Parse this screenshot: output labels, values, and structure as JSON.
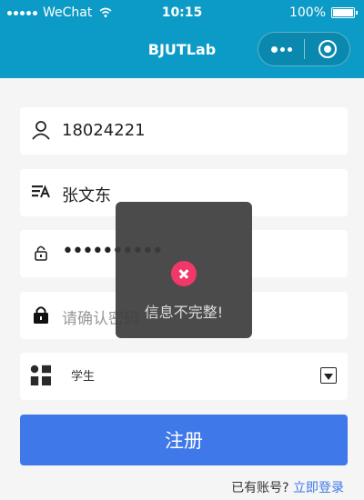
{
  "status_bar": {
    "carrier": "WeChat",
    "time": "10:15",
    "battery": "100%"
  },
  "nav": {
    "title": "BJUTLab"
  },
  "form": {
    "phone_value": "18024221",
    "name_value": "张文东",
    "password_value": "••••••••••",
    "confirm_placeholder": "请确认密码",
    "role_value": "学生",
    "register_label": "注册",
    "have_account_text": "已有账号?",
    "login_link": "立即登录"
  },
  "toast": {
    "message": "信息不完整!"
  },
  "colors": {
    "nav_bg": "#0c9bc6",
    "primary": "#3f78e8",
    "error": "#f0386a"
  },
  "icons": [
    "user-icon",
    "name-icon",
    "lock-open-icon",
    "lock-icon",
    "grid-icon",
    "dropdown-icon",
    "close-circle-icon",
    "more-icon",
    "target-icon"
  ]
}
